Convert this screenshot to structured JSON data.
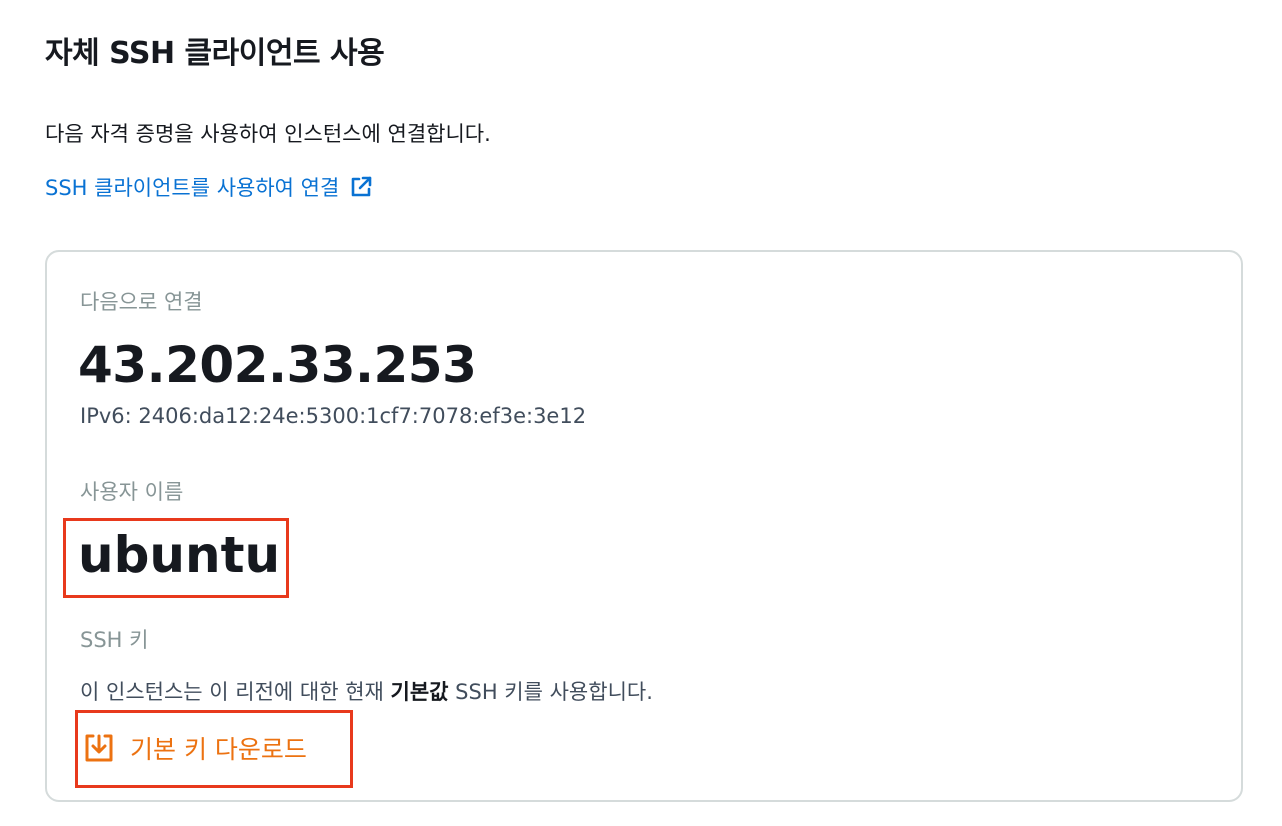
{
  "section": {
    "title": "자체 SSH 클라이언트 사용",
    "description": "다음 자격 증명을 사용하여 인스턴스에 연결합니다.",
    "link_label": "SSH 클라이언트를 사용하여 연결",
    "link_icon": "external-link-icon"
  },
  "card": {
    "connect_to_label": "다음으로 연결",
    "ipv4": "43.202.33.253",
    "ipv6": "IPv6: 2406:da12:24e:5300:1cf7:7078:ef3e:3e12",
    "username_label": "사용자 이름",
    "username": "ubuntu",
    "ssh_key_label": "SSH 키",
    "ssh_key_desc_prefix": "이 인스턴스는 이 리전에 대한 현재 ",
    "ssh_key_desc_strong": "기본값",
    "ssh_key_desc_suffix": " SSH 키를 사용합니다.",
    "download_label": "기본 키 다운로드",
    "download_icon": "download-icon"
  },
  "colors": {
    "link": "#0972d3",
    "download": "#ec7211",
    "highlight": "#e8391c",
    "muted_label": "#879596"
  }
}
